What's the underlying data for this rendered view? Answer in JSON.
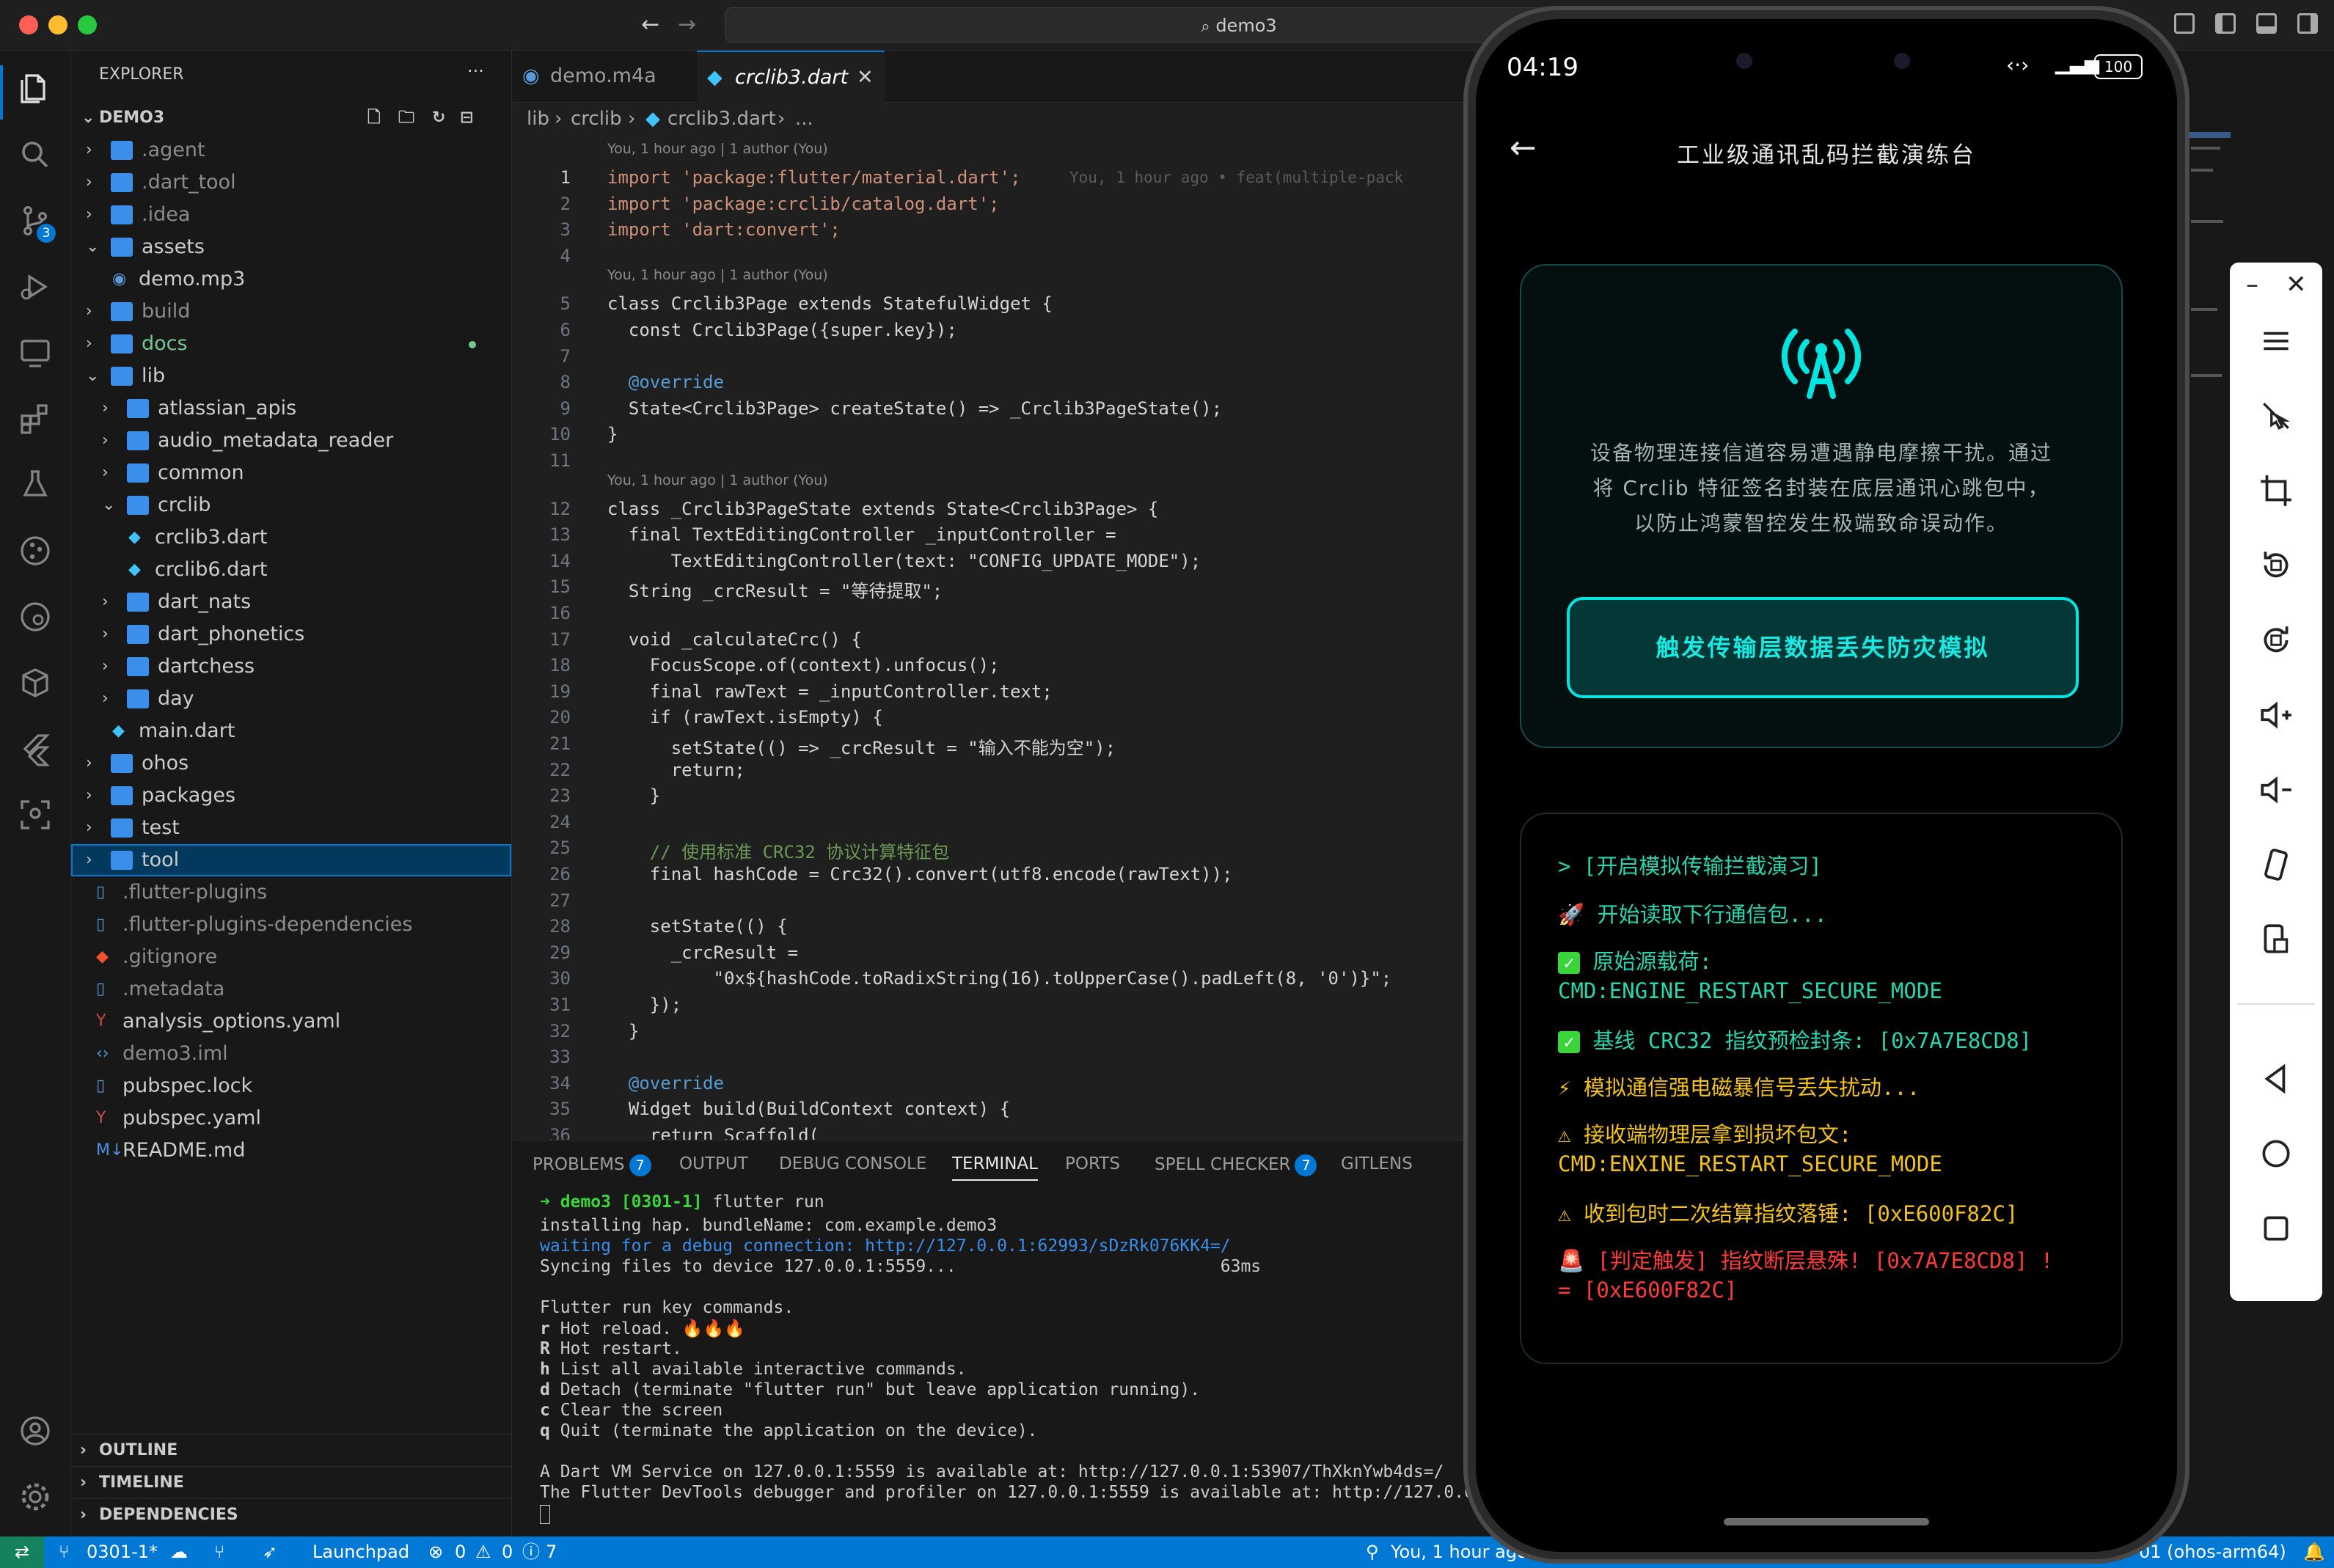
{
  "window": {
    "search": "demo3"
  },
  "activity_bar": {
    "source_control_badge": "3"
  },
  "explorer": {
    "title": "EXPLORER",
    "root": "DEMO3",
    "items": [
      {
        "label": ".agent",
        "type": "folder",
        "depth": 0,
        "open": false
      },
      {
        "label": ".dart_tool",
        "type": "folder",
        "depth": 0,
        "open": false
      },
      {
        "label": ".idea",
        "type": "folder",
        "depth": 0,
        "open": false
      },
      {
        "label": "assets",
        "type": "folder",
        "depth": 0,
        "open": true
      },
      {
        "label": "demo.mp3",
        "type": "file",
        "depth": 1,
        "icon": "audio"
      },
      {
        "label": "build",
        "type": "folder",
        "depth": 0,
        "open": false
      },
      {
        "label": "docs",
        "type": "folder",
        "depth": 0,
        "open": false,
        "modified": true
      },
      {
        "label": "lib",
        "type": "folder",
        "depth": 0,
        "open": true
      },
      {
        "label": "atlassian_apis",
        "type": "folder",
        "depth": 1,
        "open": false
      },
      {
        "label": "audio_metadata_reader",
        "type": "folder",
        "depth": 1,
        "open": false
      },
      {
        "label": "common",
        "type": "folder",
        "depth": 1,
        "open": false
      },
      {
        "label": "crclib",
        "type": "folder",
        "depth": 1,
        "open": true
      },
      {
        "label": "crclib3.dart",
        "type": "file",
        "depth": 2,
        "icon": "dart"
      },
      {
        "label": "crclib6.dart",
        "type": "file",
        "depth": 2,
        "icon": "dart"
      },
      {
        "label": "dart_nats",
        "type": "folder",
        "depth": 1,
        "open": false
      },
      {
        "label": "dart_phonetics",
        "type": "folder",
        "depth": 1,
        "open": false
      },
      {
        "label": "dartchess",
        "type": "folder",
        "depth": 1,
        "open": false
      },
      {
        "label": "day",
        "type": "folder",
        "depth": 1,
        "open": false
      },
      {
        "label": "main.dart",
        "type": "file",
        "depth": 1,
        "icon": "dart"
      },
      {
        "label": "ohos",
        "type": "folder",
        "depth": 0,
        "open": false
      },
      {
        "label": "packages",
        "type": "folder",
        "depth": 0,
        "open": false
      },
      {
        "label": "test",
        "type": "folder",
        "depth": 0,
        "open": false
      },
      {
        "label": "tool",
        "type": "folder",
        "depth": 0,
        "open": false,
        "selected": true
      },
      {
        "label": ".flutter-plugins",
        "type": "file",
        "depth": 0,
        "icon": "file"
      },
      {
        "label": ".flutter-plugins-dependencies",
        "type": "file",
        "depth": 0,
        "icon": "file"
      },
      {
        "label": ".gitignore",
        "type": "file",
        "depth": 0,
        "icon": "git"
      },
      {
        "label": ".metadata",
        "type": "file",
        "depth": 0,
        "icon": "file"
      },
      {
        "label": "analysis_options.yaml",
        "type": "file",
        "depth": 0,
        "icon": "yaml"
      },
      {
        "label": "demo3.iml",
        "type": "file",
        "depth": 0,
        "icon": "xml"
      },
      {
        "label": "pubspec.lock",
        "type": "file",
        "depth": 0,
        "icon": "file"
      },
      {
        "label": "pubspec.yaml",
        "type": "file",
        "depth": 0,
        "icon": "yaml"
      },
      {
        "label": "README.md",
        "type": "file",
        "depth": 0,
        "icon": "md"
      }
    ],
    "sections": [
      "OUTLINE",
      "TIMELINE",
      "DEPENDENCIES"
    ]
  },
  "editor": {
    "tabs": [
      {
        "label": "demo.m4a",
        "active": false
      },
      {
        "label": "crclib3.dart",
        "active": true
      }
    ],
    "breadcrumb": [
      "lib",
      "crclib",
      "crclib3.dart",
      "..."
    ],
    "blame_header": "You, 1 hour ago | 1 author (You)",
    "inline_blame": "You, 1 hour ago • feat(multiple-pack",
    "lines": [
      "import 'package:flutter/material.dart';",
      "import 'package:crclib/catalog.dart';",
      "import 'dart:convert';",
      "",
      "class Crclib3Page extends StatefulWidget {",
      "  const Crclib3Page({super.key});",
      "",
      "  @override",
      "  State<Crclib3Page> createState() => _Crclib3PageState();",
      "}",
      "",
      "class _Crclib3PageState extends State<Crclib3Page> {",
      "  final TextEditingController _inputController =",
      "      TextEditingController(text: \"CONFIG_UPDATE_MODE\");",
      "  String _crcResult = \"等待提取\";",
      "",
      "  void _calculateCrc() {",
      "    FocusScope.of(context).unfocus();",
      "    final rawText = _inputController.text;",
      "    if (rawText.isEmpty) {",
      "      setState(() => _crcResult = \"输入不能为空\");",
      "      return;",
      "    }",
      "",
      "    // 使用标准 CRC32 协议计算特征包",
      "    final hashCode = Crc32().convert(utf8.encode(rawText));",
      "",
      "    setState(() {",
      "      _crcResult =",
      "          \"0x${hashCode.toRadixString(16).toUpperCase().padLeft(8, '0')}\";",
      "    });",
      "  }",
      "",
      "  @override",
      "  Widget build(BuildContext context) {",
      "    return Scaffold("
    ]
  },
  "panel": {
    "tabs": [
      {
        "label": "PROBLEMS",
        "badge": "7"
      },
      {
        "label": "OUTPUT"
      },
      {
        "label": "DEBUG CONSOLE"
      },
      {
        "label": "TERMINAL",
        "active": true
      },
      {
        "label": "PORTS"
      },
      {
        "label": "SPELL CHECKER",
        "badge": "7"
      },
      {
        "label": "GITLENS"
      }
    ],
    "terminal": {
      "prompt_dir": "demo3 [0301-1]",
      "prompt_cmd": "flutter run",
      "lines": [
        "installing hap. bundleName: com.example.demo3",
        "waiting for a debug connection: http://127.0.0.1:62993/sDzRk076KK4=/",
        "Syncing files to device 127.0.0.1:5559...                          63ms",
        "",
        "Flutter run key commands.",
        "r Hot reload. 🔥🔥🔥",
        "R Hot restart.",
        "h List all available interactive commands.",
        "d Detach (terminate \"flutter run\" but leave application running).",
        "c Clear the screen",
        "q Quit (terminate the application on the device).",
        "",
        "A Dart VM Service on 127.0.0.1:5559 is available at: http://127.0.0.1:53907/ThXknYwb4ds=/",
        "The Flutter DevTools debugger and profiler on 127.0.0.1:5559 is available at: http://127.0.0"
      ]
    }
  },
  "status_bar": {
    "branch": "0301-1*",
    "launchpad": "Launchpad",
    "errors": "0",
    "warnings": "0",
    "info": "7",
    "blame": "You, 1 hour ago",
    "device": "01 (ohos-arm64)"
  },
  "phone": {
    "time": "04:19",
    "battery": "100",
    "app_title": "工业级通讯乱码拦截演练台",
    "description": "设备物理连接信道容易遭遇静电摩擦干扰。通过将 Crclib 特征签名封装在底层通讯心跳包中，以防止鸿蒙智控发生极端致命误动作。",
    "description_lines": [
      "设备物理连接信道容易遭遇静电摩擦干扰。通过",
      "将 Crclib 特征签名封装在底层通讯心跳包中，",
      "以防止鸿蒙智控发生极端致命误动作。"
    ],
    "action_button": "触发传输层数据丢失防灾模拟",
    "log": {
      "header": "> [开启模拟传输拦截演习]",
      "l1": "开始读取下行通信包...",
      "l2a": "原始源载荷:",
      "l2b": "CMD:ENGINE_RESTART_SECURE_MODE",
      "l3": "基线 CRC32 指纹预检封条: [0x7A7E8CD8]",
      "l4": "模拟通信强电磁暴信号丢失扰动...",
      "l5a": "接收端物理层拿到损坏包文:",
      "l5b": "CMD:ENXINE_RESTART_SECURE_MODE",
      "l6": "收到包时二次结算指纹落锤: [0xE600F82C]",
      "l7a": "[判定触发] 指纹断层悬殊! [0x7A7E8CD8] !",
      "l7b": "= [0xE600F82C]"
    },
    "colors": {
      "accent": "#00e5e0",
      "ok": "#3ad53a",
      "warn": "#f2c21b",
      "error": "#ff3b3b",
      "log_text": "#28d7b0"
    }
  }
}
